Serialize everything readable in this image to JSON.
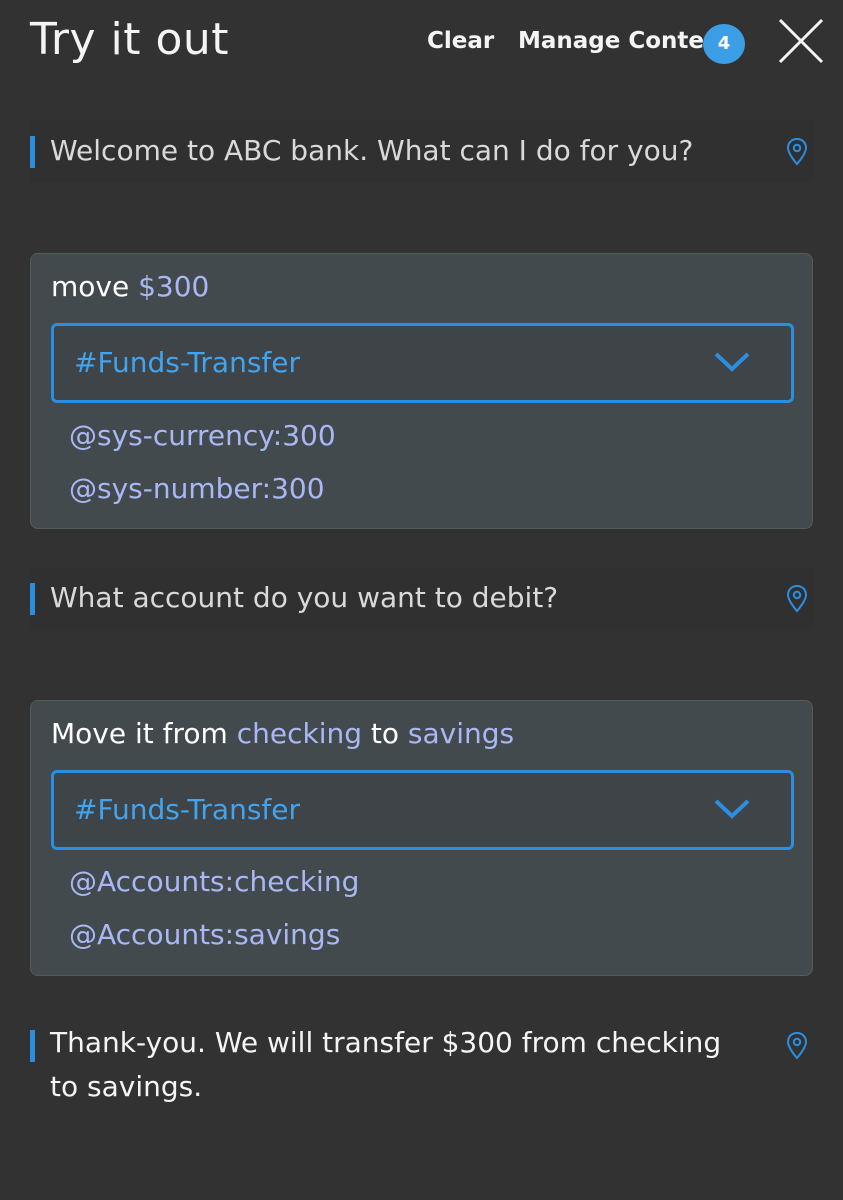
{
  "header": {
    "title": "Try it out",
    "clear_label": "Clear",
    "manage_context_label": "Manage Context",
    "context_count": "4"
  },
  "conversation": {
    "bot_message_1": "Welcome to ABC bank. What can I do for you?",
    "user_message_1": {
      "parts": [
        "move ",
        "$300"
      ],
      "intent": "#Funds-Transfer",
      "entities": [
        "@sys-currency:300",
        "@sys-number:300"
      ]
    },
    "bot_message_2": "What account do you want to debit?",
    "user_message_2": {
      "parts": [
        "Move it from ",
        "checking",
        " to ",
        "savings"
      ],
      "intent": "#Funds-Transfer",
      "entities": [
        "@Accounts:checking",
        "@Accounts:savings"
      ]
    },
    "bot_message_3": "Thank-you. We will transfer $300 from checking to savings."
  },
  "colors": {
    "background": "#323232",
    "accent": "#2b8ee0",
    "entity_highlight": "#a9b8f5",
    "badge": "#3d9ee8"
  },
  "icons": {
    "close": "close-icon",
    "pin": "location-pin-icon",
    "chevron": "chevron-down-icon"
  }
}
